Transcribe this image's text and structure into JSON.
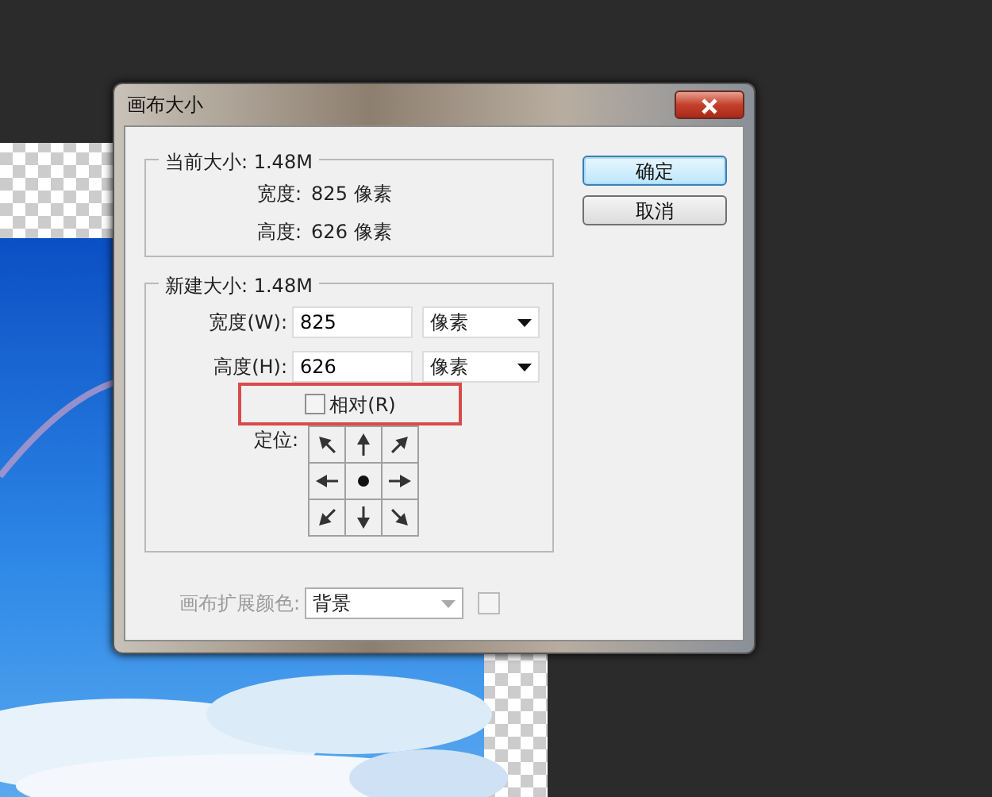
{
  "window": {
    "title": "画布大小"
  },
  "current_size": {
    "legend": "当前大小: 1.48M",
    "rows": [
      {
        "label": "宽度:",
        "value": "825 像素"
      },
      {
        "label": "高度:",
        "value": "626 像素"
      }
    ]
  },
  "new_size": {
    "legend": "新建大小: 1.48M",
    "fields": [
      {
        "label": "宽度(W):",
        "value": "825",
        "unit": "像素"
      },
      {
        "label": "高度(H):",
        "value": "626",
        "unit": "像素"
      }
    ],
    "relative": {
      "label": "相对(R)",
      "checked": false,
      "highlighted": true
    },
    "anchor": {
      "label": "定位:",
      "cells": [
        {
          "selected": false
        },
        {
          "selected": false
        },
        {
          "selected": false
        },
        {
          "selected": false
        },
        {
          "selected": true
        },
        {
          "selected": false
        },
        {
          "selected": false
        },
        {
          "selected": false
        },
        {
          "selected": false
        }
      ]
    }
  },
  "extension_color": {
    "label": "画布扩展颜色:",
    "value": "背景",
    "disabled": true
  },
  "buttons": [
    {
      "label": "确定",
      "default": true
    },
    {
      "label": "取消",
      "default": false
    }
  ]
}
